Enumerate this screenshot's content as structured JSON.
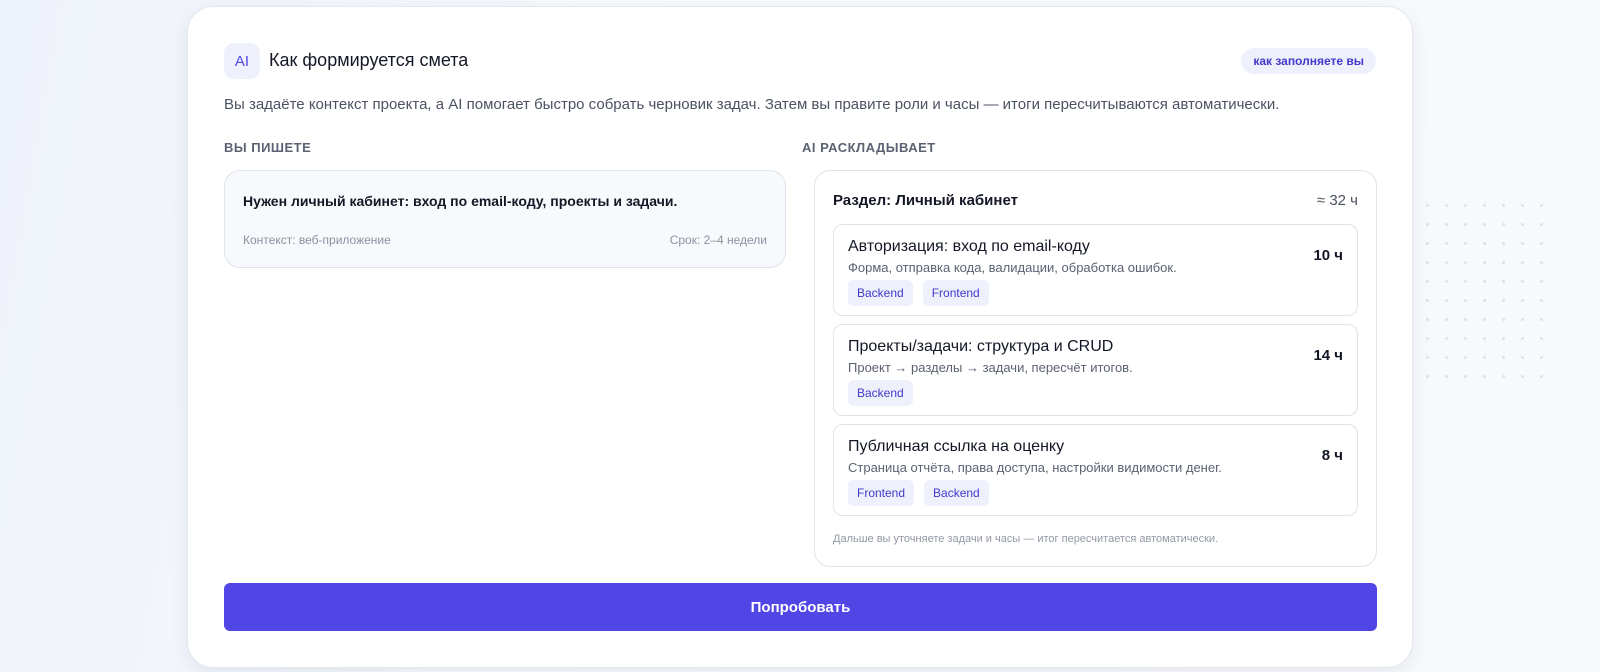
{
  "header": {
    "badge": "AI",
    "title": "Как формируется смета",
    "pill": "как заполняете вы"
  },
  "subtitle": "Вы задаёте контекст проекта, а AI помогает быстро собрать черновик задач. Затем вы правите роли и часы — итоги пересчитываются автоматически.",
  "left": {
    "label": "ВЫ ПИШЕТЕ",
    "request": "Нужен личный кабинет: вход по email-коду, проекты и задачи.",
    "context": "Контекст: веб-приложение",
    "deadline": "Срок: 2–4 недели"
  },
  "right": {
    "label": "AI РАСКЛАДЫВАЕТ",
    "section_title": "Раздел: Личный кабинет",
    "section_total": "≈ 32 ч",
    "tasks": [
      {
        "title": "Авторизация: вход по email-коду",
        "hours": "10 ч",
        "desc": "Форма, отправка кода, валидации, обработка ошибок.",
        "tags": [
          "Backend",
          "Frontend"
        ]
      },
      {
        "title": "Проекты/задачи: структура и CRUD",
        "hours": "14 ч",
        "desc": "Проект → разделы → задачи, пересчёт итогов.",
        "tags": [
          "Backend"
        ]
      },
      {
        "title": "Публичная ссылка на оценку",
        "hours": "8 ч",
        "desc": "Страница отчёта, права доступа, настройки видимости денег.",
        "tags": [
          "Frontend",
          "Backend"
        ]
      }
    ],
    "footnote": "Дальше вы уточняете задачи и часы — итог пересчитается автоматически."
  },
  "cta": {
    "label": "Попробовать"
  },
  "colors": {
    "accent": "#4f46e5",
    "tag_bg": "#eef0fb"
  }
}
